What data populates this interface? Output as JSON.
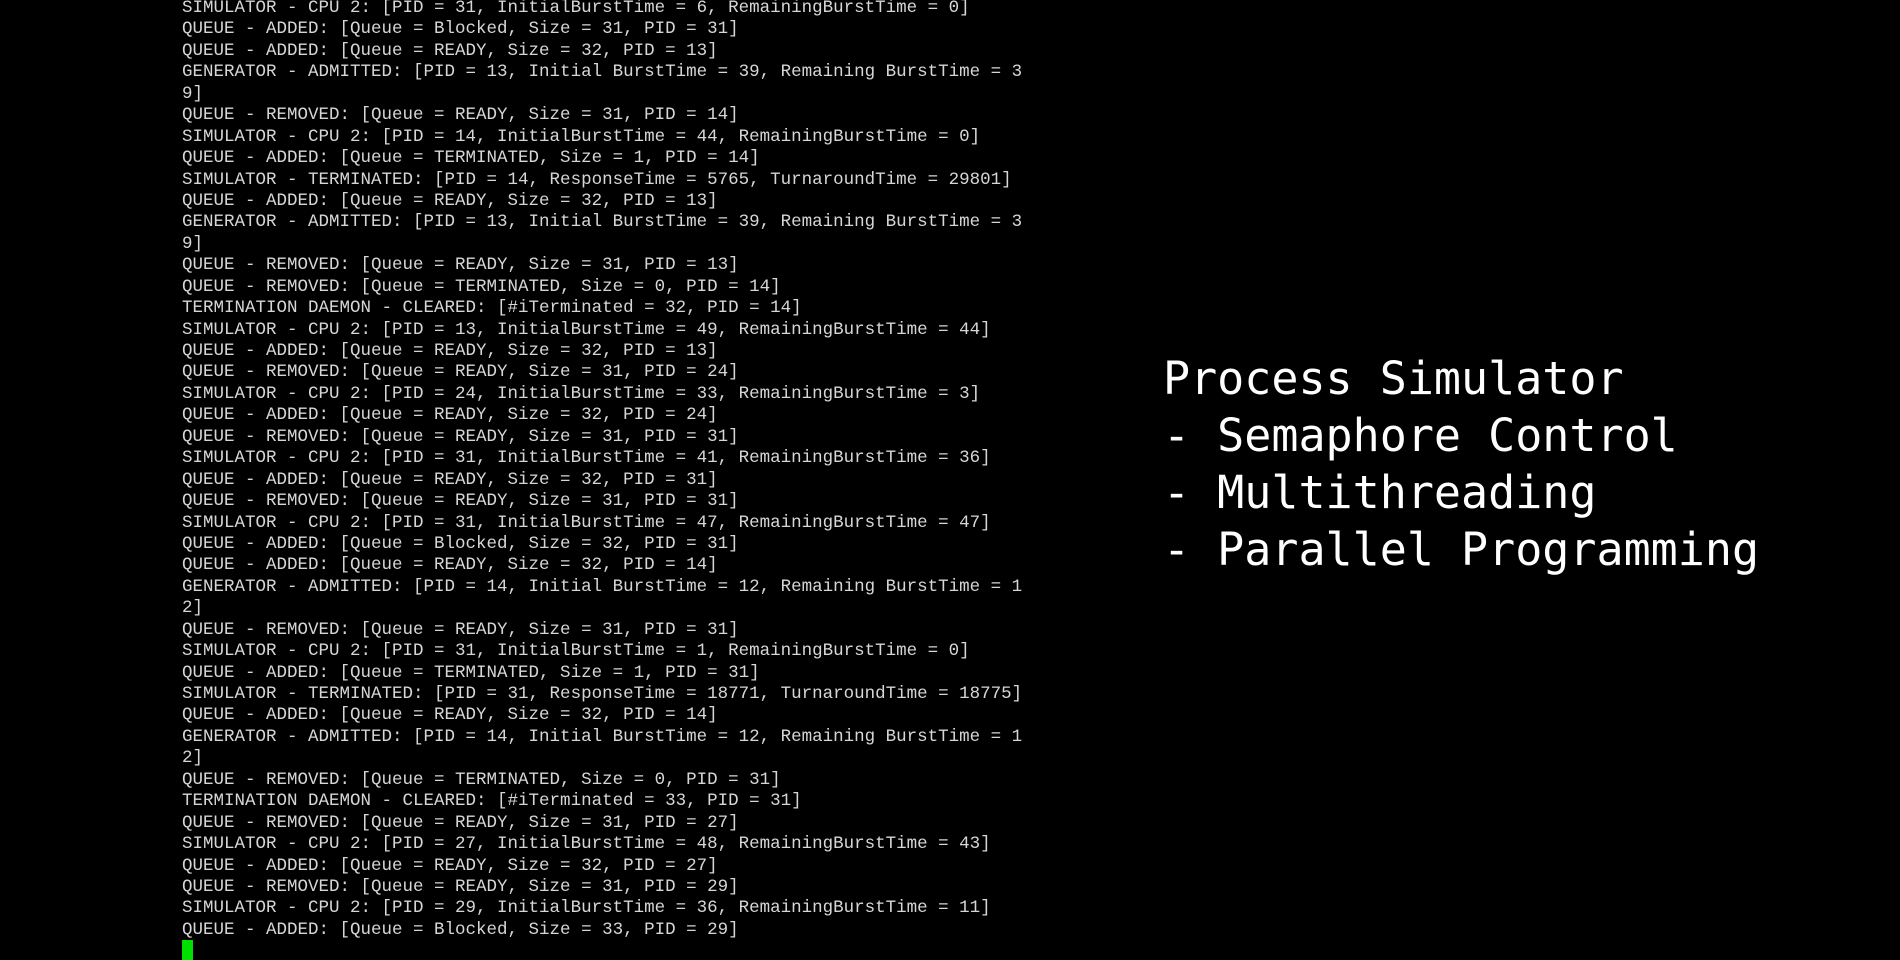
{
  "terminal": {
    "lines": [
      "SIMULATOR - CPU 2: [PID = 31, InitialBurstTime = 6, RemainingBurstTime = 0]",
      "QUEUE - ADDED: [Queue = Blocked, Size = 31, PID = 31]",
      "QUEUE - ADDED: [Queue = READY, Size = 32, PID = 13]",
      "GENERATOR - ADMITTED: [PID = 13, Initial BurstTime = 39, Remaining BurstTime = 3",
      "9]",
      "QUEUE - REMOVED: [Queue = READY, Size = 31, PID = 14]",
      "SIMULATOR - CPU 2: [PID = 14, InitialBurstTime = 44, RemainingBurstTime = 0]",
      "QUEUE - ADDED: [Queue = TERMINATED, Size = 1, PID = 14]",
      "SIMULATOR - TERMINATED: [PID = 14, ResponseTime = 5765, TurnaroundTime = 29801]",
      "QUEUE - ADDED: [Queue = READY, Size = 32, PID = 13]",
      "GENERATOR - ADMITTED: [PID = 13, Initial BurstTime = 39, Remaining BurstTime = 3",
      "9]",
      "QUEUE - REMOVED: [Queue = READY, Size = 31, PID = 13]",
      "QUEUE - REMOVED: [Queue = TERMINATED, Size = 0, PID = 14]",
      "TERMINATION DAEMON - CLEARED: [#iTerminated = 32, PID = 14]",
      "SIMULATOR - CPU 2: [PID = 13, InitialBurstTime = 49, RemainingBurstTime = 44]",
      "QUEUE - ADDED: [Queue = READY, Size = 32, PID = 13]",
      "QUEUE - REMOVED: [Queue = READY, Size = 31, PID = 24]",
      "SIMULATOR - CPU 2: [PID = 24, InitialBurstTime = 33, RemainingBurstTime = 3]",
      "QUEUE - ADDED: [Queue = READY, Size = 32, PID = 24]",
      "QUEUE - REMOVED: [Queue = READY, Size = 31, PID = 31]",
      "SIMULATOR - CPU 2: [PID = 31, InitialBurstTime = 41, RemainingBurstTime = 36]",
      "QUEUE - ADDED: [Queue = READY, Size = 32, PID = 31]",
      "QUEUE - REMOVED: [Queue = READY, Size = 31, PID = 31]",
      "SIMULATOR - CPU 2: [PID = 31, InitialBurstTime = 47, RemainingBurstTime = 47]",
      "QUEUE - ADDED: [Queue = Blocked, Size = 32, PID = 31]",
      "QUEUE - ADDED: [Queue = READY, Size = 32, PID = 14]",
      "GENERATOR - ADMITTED: [PID = 14, Initial BurstTime = 12, Remaining BurstTime = 1",
      "2]",
      "QUEUE - REMOVED: [Queue = READY, Size = 31, PID = 31]",
      "SIMULATOR - CPU 2: [PID = 31, InitialBurstTime = 1, RemainingBurstTime = 0]",
      "QUEUE - ADDED: [Queue = TERMINATED, Size = 1, PID = 31]",
      "SIMULATOR - TERMINATED: [PID = 31, ResponseTime = 18771, TurnaroundTime = 18775]",
      "QUEUE - ADDED: [Queue = READY, Size = 32, PID = 14]",
      "GENERATOR - ADMITTED: [PID = 14, Initial BurstTime = 12, Remaining BurstTime = 1",
      "2]",
      "QUEUE - REMOVED: [Queue = TERMINATED, Size = 0, PID = 31]",
      "TERMINATION DAEMON - CLEARED: [#iTerminated = 33, PID = 31]",
      "QUEUE - REMOVED: [Queue = READY, Size = 31, PID = 27]",
      "SIMULATOR - CPU 2: [PID = 27, InitialBurstTime = 48, RemainingBurstTime = 43]",
      "QUEUE - ADDED: [Queue = READY, Size = 32, PID = 27]",
      "QUEUE - REMOVED: [Queue = READY, Size = 31, PID = 29]",
      "SIMULATOR - CPU 2: [PID = 29, InitialBurstTime = 36, RemainingBurstTime = 11]",
      "QUEUE - ADDED: [Queue = Blocked, Size = 33, PID = 29]"
    ],
    "text_color": "#d6d6d6",
    "background_color": "#000000",
    "cursor_color": "#00e000"
  },
  "caption": {
    "lines": [
      "Process Simulator",
      "- Semaphore Control",
      "- Multithreading",
      "- Parallel Programming"
    ],
    "text_color": "#ffffff"
  }
}
